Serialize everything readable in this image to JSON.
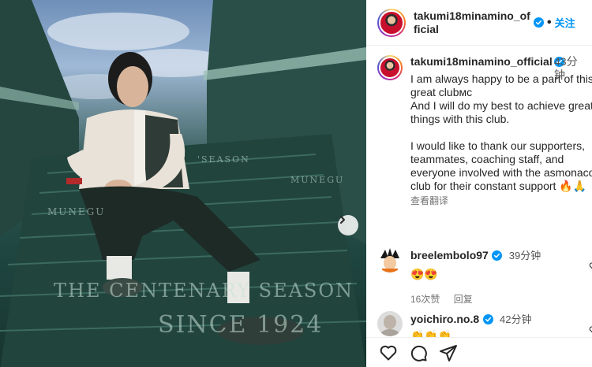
{
  "post": {
    "header": {
      "username": "takumi18minamino_official",
      "separator": "•",
      "follow_label": "关注"
    },
    "caption": {
      "username": "takumi18minamino_official",
      "time": "43分钟",
      "text": "I am always happy to be a part of this great clubᴍᴄ\nAnd I will do my best to achieve great things with this club.\n\nI would like to thank our supporters, teammates, coaching staff, and everyone involved with the asmonaco club for their constant support 🔥🙏",
      "translate_label": "查看翻译"
    },
    "comments": [
      {
        "username": "breelembolo97",
        "time": "39分钟",
        "text": "😍😍",
        "likes": "16次赞",
        "reply_label": "回复"
      },
      {
        "username": "yoichiro.no.8",
        "time": "42分钟",
        "text": "👏👏👏"
      }
    ],
    "photo": {
      "stair_texts": [
        "MUNEGU",
        "MUNEGU",
        "THE CENTENARY SEASON",
        "SINCE 1924",
        "'SEASON"
      ]
    }
  },
  "colors": {
    "accent": "#0095f6",
    "verified": "#0095f6",
    "photo_green": "#1f4540"
  },
  "icons": [
    "next-arrow-icon",
    "verified-icon",
    "heart-icon",
    "comment-icon",
    "share-icon"
  ]
}
